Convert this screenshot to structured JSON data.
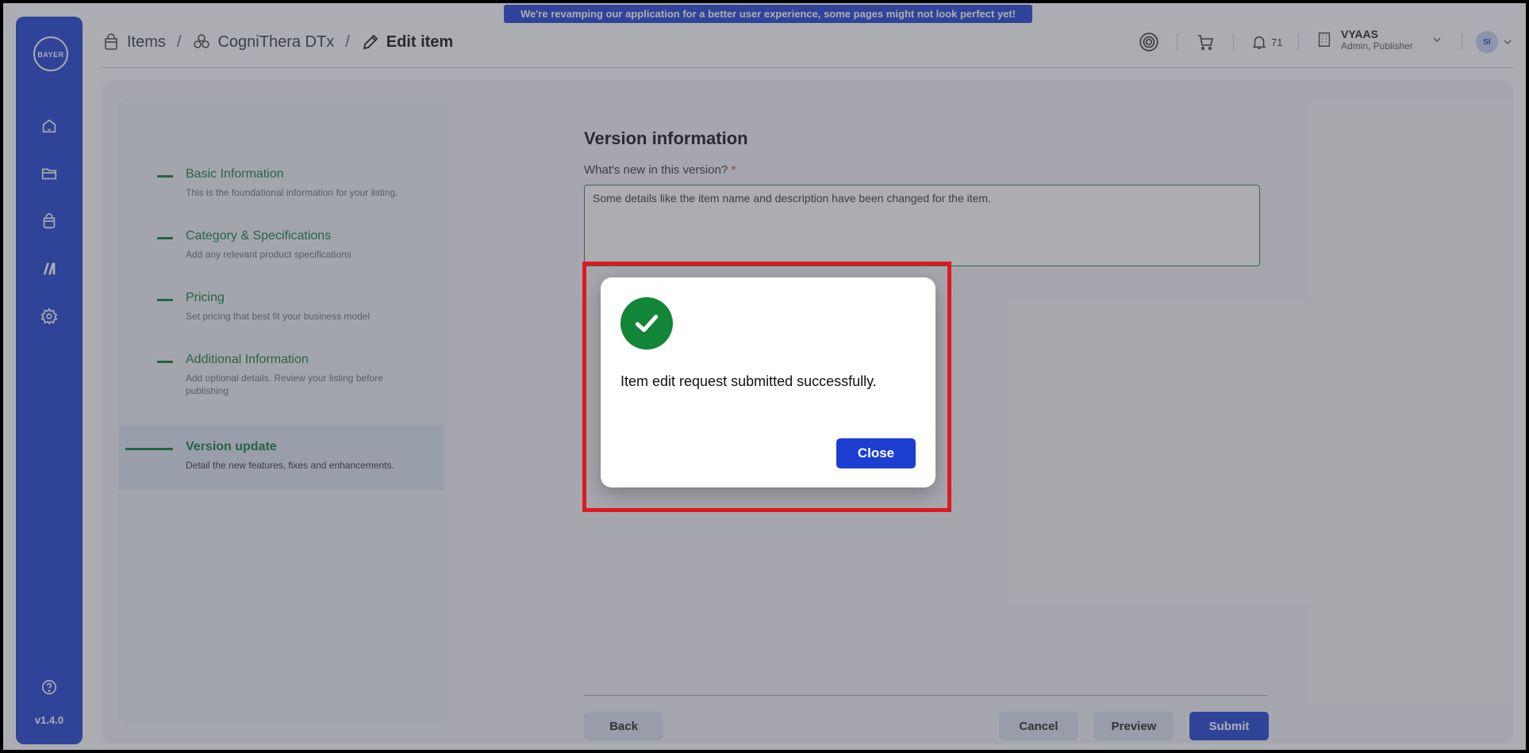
{
  "banner": {
    "text": "We're revamping our application for a better user experience, some pages might not look perfect yet!"
  },
  "sidebar": {
    "logo_text": "BAYER",
    "items": [
      {
        "icon": "home-icon"
      },
      {
        "icon": "folder-icon"
      },
      {
        "icon": "bag-icon"
      },
      {
        "icon": "bars-icon"
      },
      {
        "icon": "gear-icon"
      }
    ],
    "help_icon": "help-icon",
    "version": "v1.4.0"
  },
  "breadcrumb": {
    "items_label": "Items",
    "product_label": "CogniThera DTx",
    "current_label": "Edit item",
    "separator": "/"
  },
  "header": {
    "notification_count": "71",
    "user_name": "VYAAS",
    "user_role": "Admin, Publisher",
    "avatar_initials": "SI"
  },
  "steps": [
    {
      "title": "Basic Information",
      "desc": "This is the foundational information for your listing."
    },
    {
      "title": "Category & Specifications",
      "desc": "Add any relevant product specifications"
    },
    {
      "title": "Pricing",
      "desc": "Set pricing that best fit your business model"
    },
    {
      "title": "Additional Information",
      "desc": "Add optional details. Review your listing before publishing"
    },
    {
      "title": "Version update",
      "desc": "Detail the new features, fixes and enhancements."
    }
  ],
  "form": {
    "title": "Version information",
    "label": "What's new in this version?",
    "required_mark": "*",
    "value": "Some details like the item name and description have been changed for the item."
  },
  "footer": {
    "back": "Back",
    "cancel": "Cancel",
    "preview": "Preview",
    "submit": "Submit"
  },
  "modal": {
    "message": "Item edit request submitted successfully.",
    "close": "Close"
  },
  "colors": {
    "brand": "#1c3ed1",
    "success": "#138538",
    "step_green": "#0d7a35",
    "highlight": "#e0191f"
  }
}
